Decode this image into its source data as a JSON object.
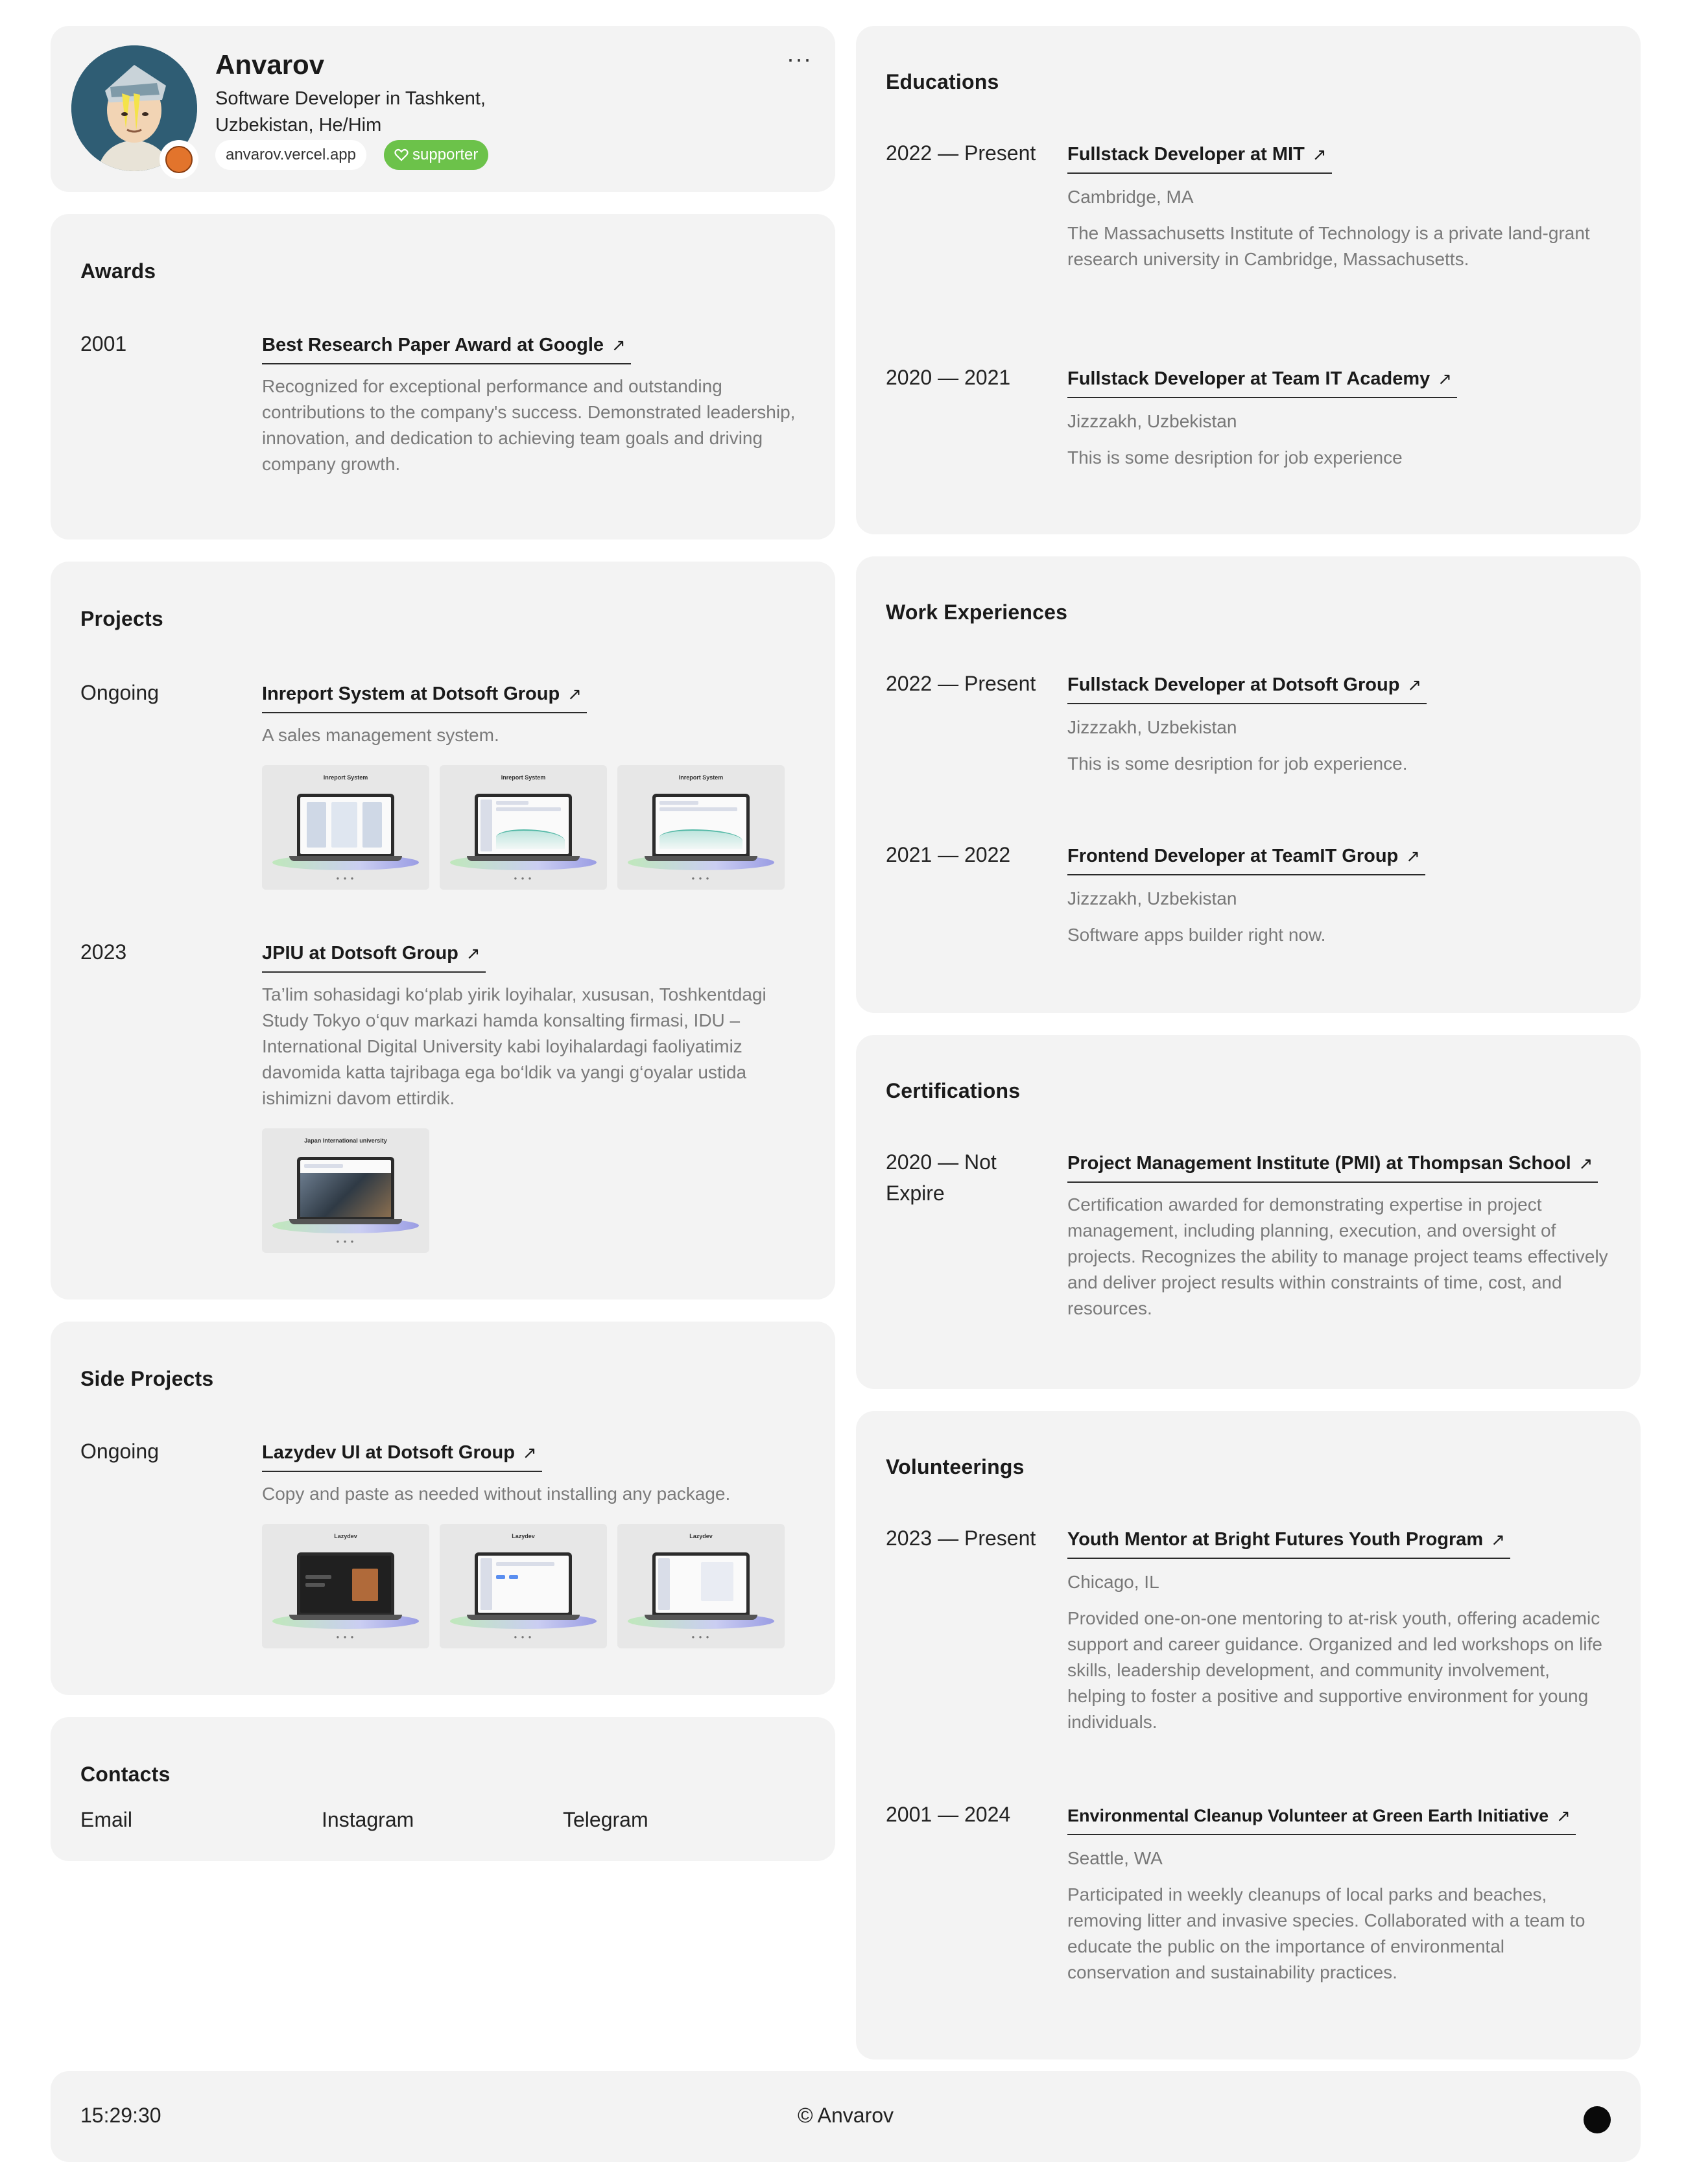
{
  "profile": {
    "name": "Anvarov",
    "role": "Software Developer in Tashkent, Uzbekistan, He/Him",
    "site": "anvarov.vercel.app",
    "supporter": "supporter",
    "more": "···"
  },
  "awards": {
    "title": "Awards",
    "items": [
      {
        "date": "2001",
        "title": "Best Research Paper Award at Google",
        "desc": "Recognized for exceptional performance and outstanding contributions to the company's success. Demonstrated leadership, innovation, and dedication to achieving team goals and driving company growth."
      }
    ]
  },
  "projects": {
    "title": "Projects",
    "items": [
      {
        "date": "Ongoing",
        "title": "Inreport System at Dotsoft Group",
        "desc": "A sales management system.",
        "thumb_title": "Inreport System"
      },
      {
        "date": "2023",
        "title": "JPIU at Dotsoft Group",
        "desc": "Ta’lim sohasidagi ko‘plab yirik loyihalar, xususan, Toshkentdagi Study Tokyo o‘quv markazi hamda konsalting firmasi, IDU – International Digital University kabi loyihalardagi faoliyatimiz davomida katta tajribaga ega bo‘ldik va yangi g‘oyalar ustida ishimizni davom ettirdik.",
        "thumb_title": "Japan International university"
      }
    ]
  },
  "side_projects": {
    "title": "Side Projects",
    "items": [
      {
        "date": "Ongoing",
        "title": "Lazydev UI at Dotsoft Group",
        "desc": "Copy and paste as needed without installing any package.",
        "thumb_title": "Lazydev"
      }
    ]
  },
  "contacts": {
    "title": "Contacts",
    "links": [
      "Email",
      "Instagram",
      "Telegram"
    ]
  },
  "educations": {
    "title": "Educations",
    "items": [
      {
        "date": "2022 — Present",
        "title": "Fullstack Developer at MIT",
        "loc": "Cambridge, MA",
        "desc": "The Massachusetts Institute of Technology is a private land-grant research university in Cambridge, Massachusetts."
      },
      {
        "date": "2020 — 2021",
        "title": "Fullstack Developer at Team IT Academy",
        "loc": "Jizzzakh, Uzbekistan",
        "desc": "This is some desription for job experience"
      }
    ]
  },
  "work": {
    "title": "Work Experiences",
    "items": [
      {
        "date": "2022 — Present",
        "title": "Fullstack Developer at Dotsoft Group",
        "loc": "Jizzzakh, Uzbekistan",
        "desc": "This is some desription for job experience."
      },
      {
        "date": "2021 — 2022",
        "title": "Frontend Developer at TeamIT Group",
        "loc": "Jizzzakh, Uzbekistan",
        "desc": "Software apps builder right now."
      }
    ]
  },
  "certifications": {
    "title": "Certifications",
    "items": [
      {
        "date": "2020 — Not Expire",
        "title": "Project Management Institute (PMI) at Thompsan School",
        "desc": "Certification awarded for demonstrating expertise in project management, including planning, execution, and oversight of projects. Recognizes the ability to manage project teams effectively and deliver project results within constraints of time, cost, and resources."
      }
    ]
  },
  "volunteerings": {
    "title": "Volunteerings",
    "items": [
      {
        "date": "2023 — Present",
        "title": "Youth Mentor at Bright Futures Youth Program",
        "loc": "Chicago, IL",
        "desc": "Provided one-on-one mentoring to at-risk youth, offering academic support and career guidance. Organized and led workshops on life skills, leadership development, and community involvement, helping to foster a positive and supportive environment for young individuals."
      },
      {
        "date": "2001 — 2024",
        "title": "Environmental Cleanup Volunteer at Green Earth Initiative",
        "loc": "Seattle, WA",
        "desc": "Participated in weekly cleanups of local parks and beaches, removing litter and invasive species. Collaborated with a team to educate the public on the importance of environmental conservation and sustainability practices."
      }
    ]
  },
  "footer": {
    "time": "15:29:30",
    "copyright": "© Anvarov"
  },
  "link_arrow": "↗",
  "colors": {
    "card_bg": "#f3f3f3",
    "supporter_green": "#6cc24a",
    "muted_text": "#7a7a7a"
  }
}
